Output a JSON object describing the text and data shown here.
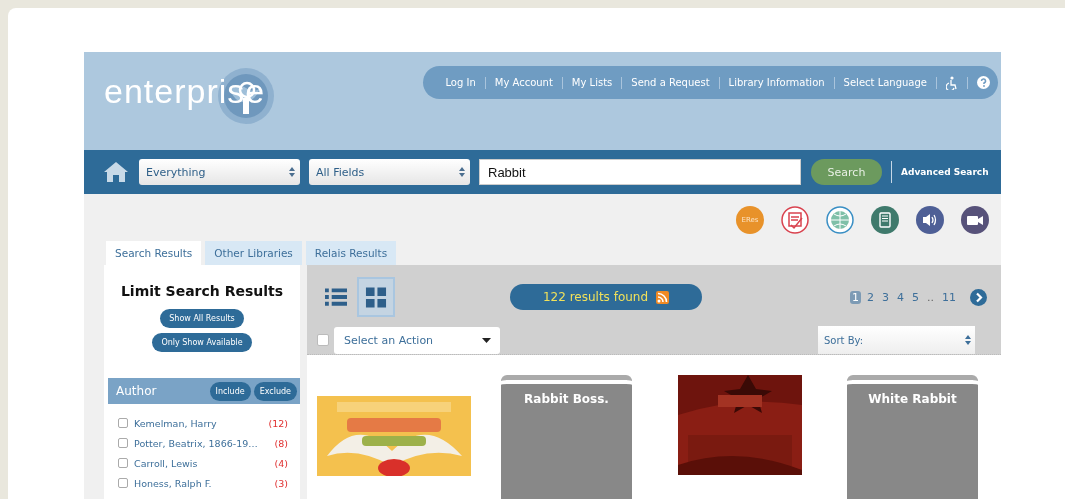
{
  "logo": {
    "text": "enterprise"
  },
  "top_links": [
    {
      "label": "Log In"
    },
    {
      "label": "My Account"
    },
    {
      "label": "My Lists"
    },
    {
      "label": "Send a Request"
    },
    {
      "label": "Library Information"
    },
    {
      "label": "Select Language"
    }
  ],
  "search": {
    "scope": "Everything",
    "field": "All Fields",
    "query": "Rabbit",
    "button": "Search",
    "advanced": "Advanced Search"
  },
  "format_icons": [
    {
      "kind": "text",
      "label": "ERes",
      "color": "#e8922a"
    },
    {
      "kind": "checklist",
      "color": "#d9434f"
    },
    {
      "kind": "globe",
      "color": "#3a8fc4"
    },
    {
      "kind": "ebook",
      "color": "#3f7a6c"
    },
    {
      "kind": "audio",
      "color": "#4e5f96"
    },
    {
      "kind": "video",
      "color": "#57527a"
    }
  ],
  "tabs": [
    {
      "label": "Search Results",
      "selected": true
    },
    {
      "label": "Other Libraries",
      "selected": false
    },
    {
      "label": "Relais Results",
      "selected": false
    }
  ],
  "sidebar": {
    "title": "Limit Search Results",
    "buttons": [
      "Show All Results",
      "Only Show Available"
    ],
    "facet": {
      "title": "Author",
      "actions": [
        "Include",
        "Exclude"
      ],
      "items": [
        {
          "label": "Kemelman, Harry",
          "count": "(12)",
          "checked": false
        },
        {
          "label": "Potter, Beatrix, 1866-19…",
          "count": "(8)",
          "checked": false
        },
        {
          "label": "Carroll, Lewis",
          "count": "(4)",
          "checked": false
        },
        {
          "label": "Honess, Ralph F.",
          "count": "(3)",
          "checked": false
        }
      ]
    }
  },
  "results": {
    "view_modes": [
      {
        "kind": "list",
        "selected": false
      },
      {
        "kind": "grid",
        "selected": true
      }
    ],
    "count": "122 results found",
    "pages": [
      {
        "kind": "page",
        "label": "1",
        "selected": true
      },
      {
        "kind": "page",
        "label": "2",
        "selected": false
      },
      {
        "kind": "page",
        "label": "3",
        "selected": false
      },
      {
        "kind": "page",
        "label": "4",
        "selected": false
      },
      {
        "kind": "page",
        "label": "5",
        "selected": false
      },
      {
        "kind": "gap",
        "label": ".."
      },
      {
        "kind": "page",
        "label": "11",
        "selected": false
      }
    ],
    "select_all": {
      "checked": false
    },
    "action": "Select an Action",
    "sort": "Sort By:",
    "books": [
      {
        "kind": "cover"
      },
      {
        "kind": "placeholder",
        "title": "Rabbit Boss."
      },
      {
        "kind": "cover"
      },
      {
        "kind": "placeholder",
        "title": "White Rabbit"
      }
    ]
  }
}
